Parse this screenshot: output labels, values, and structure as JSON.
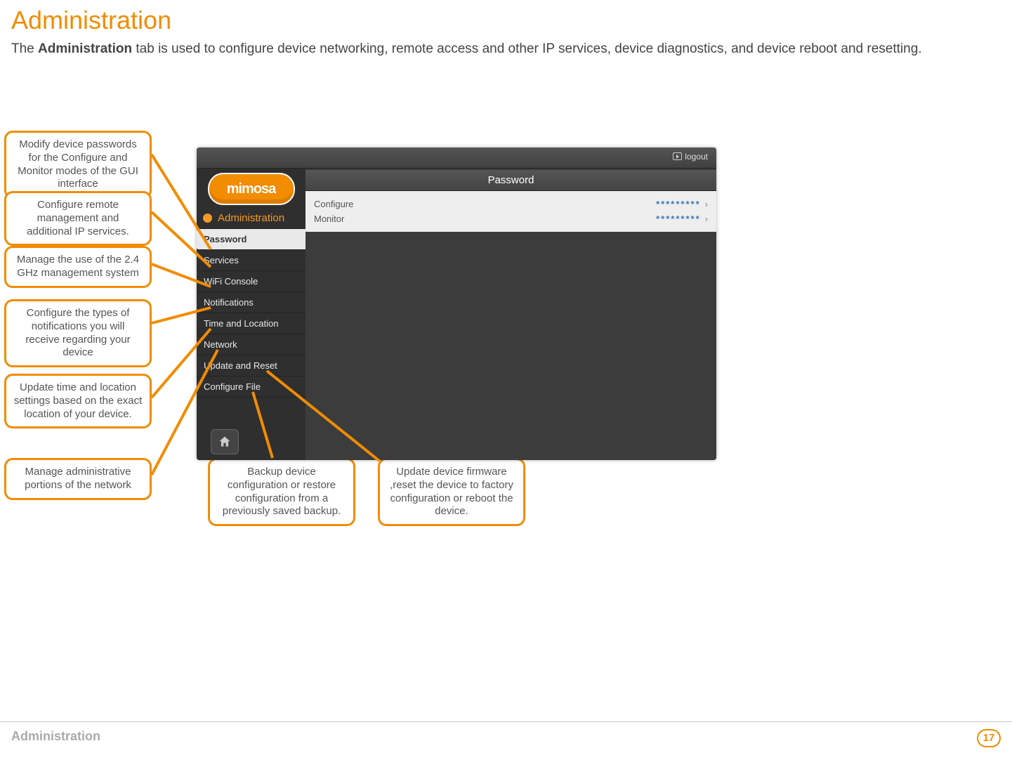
{
  "title": "Administration",
  "intro_prefix": "The ",
  "intro_bold": "Administration",
  "intro_rest": " tab is used to configure device networking, remote access and other IP services, device diagnostics, and device reboot and resetting.",
  "callouts": {
    "c1": "Modify device passwords for the Configure and Monitor modes of the GUI interface",
    "c2": "Configure remote management and additional IP services.",
    "c3": "Manage the use of the 2.4 GHz management system",
    "c4": "Configure the types of notifications you will receive regarding your device",
    "c5": "Update time and location settings based on the exact location of your device.",
    "c6": "Manage administrative portions of the network",
    "c7": "Backup device configuration or restore configuration from a previously saved backup.",
    "c8": "Update device firmware ,reset the device to factory configuration or reboot the device."
  },
  "screenshot": {
    "logout": "logout",
    "logo": "mimosa",
    "section": "Administration",
    "nav": [
      "Password",
      "Services",
      "WiFi Console",
      "Notifications",
      "Time and Location",
      "Network",
      "Update and Reset",
      "Configure File"
    ],
    "panel_title": "Password",
    "rows": [
      {
        "label": "Configure",
        "value": "*********"
      },
      {
        "label": "Monitor",
        "value": "*********"
      }
    ]
  },
  "footer_label": "Administration",
  "page_number": "17"
}
